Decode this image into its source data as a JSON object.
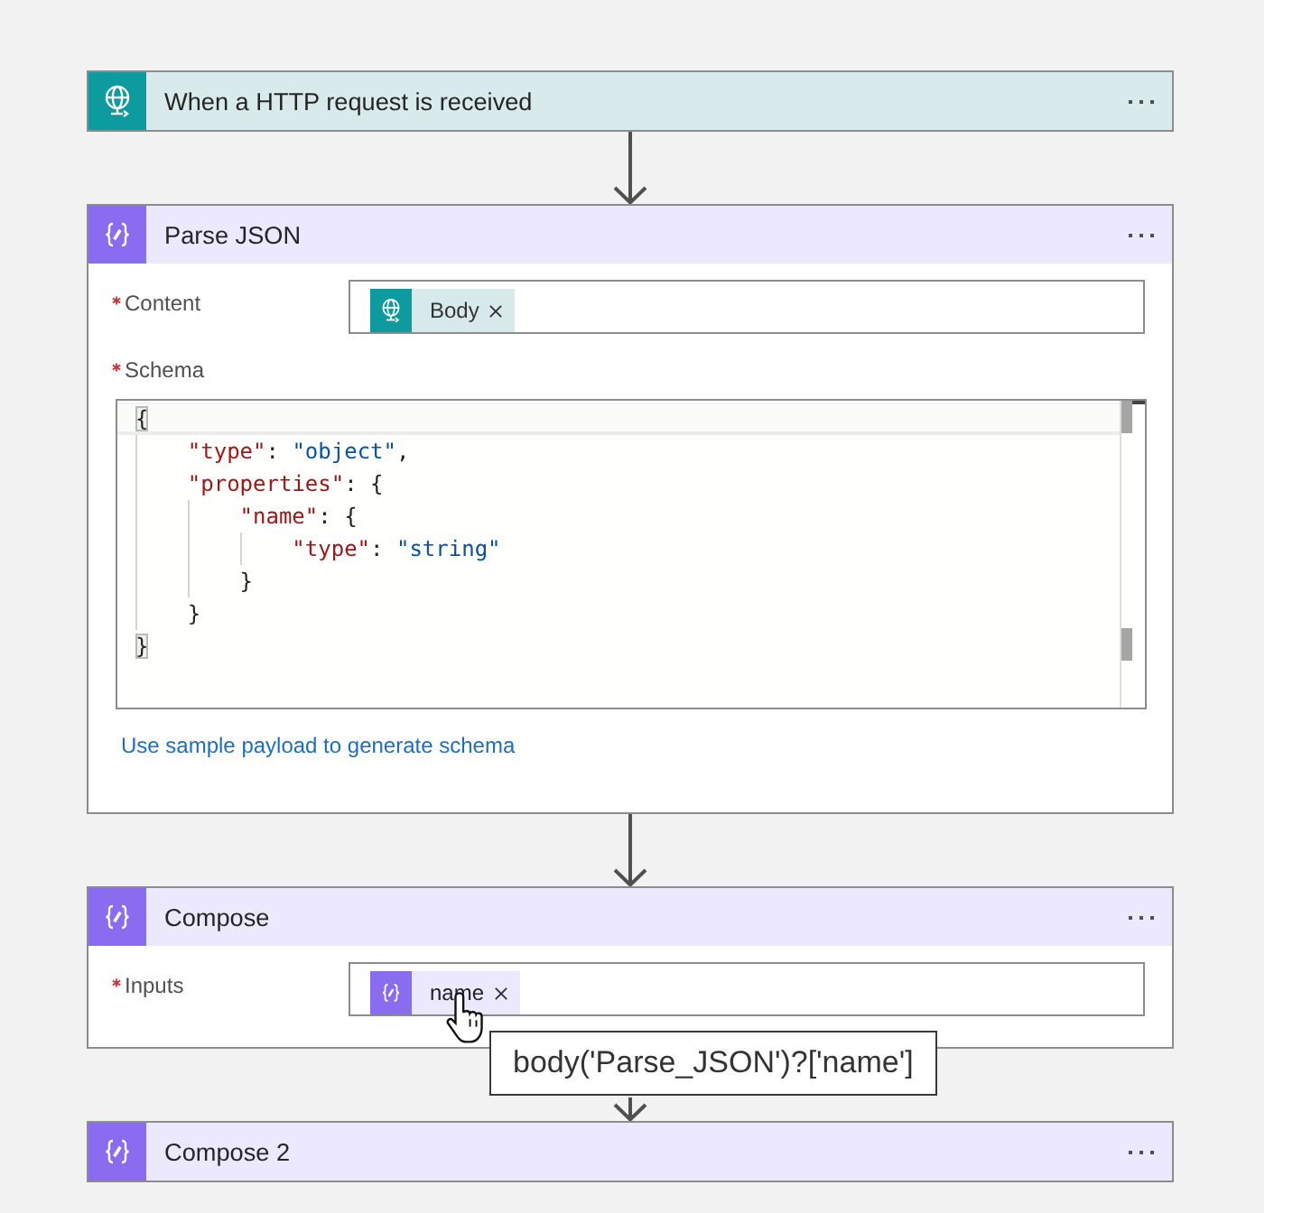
{
  "cards": [
    {
      "kind": "trigger",
      "title": "When a HTTP request is received"
    },
    {
      "kind": "action",
      "title": "Parse JSON",
      "fields": [
        {
          "kind": "tokens",
          "label": "Content",
          "required": true,
          "tokens": [
            {
              "kind": "trigger",
              "text": "Body",
              "hovered": false
            }
          ]
        },
        {
          "kind": "code",
          "label": "Schema",
          "required": true,
          "code": {
            "active": true,
            "open": [
              {
                "kind": "punct",
                "text": "{"
              }
            ],
            "children": [
              {
                "active": false,
                "open": [
                  {
                    "kind": "key",
                    "text": "\"type\""
                  },
                  {
                    "kind": "punct",
                    "text": ": "
                  },
                  {
                    "kind": "string",
                    "text": "\"object\""
                  },
                  {
                    "kind": "punct",
                    "text": ","
                  }
                ]
              },
              {
                "active": false,
                "open": [
                  {
                    "kind": "key",
                    "text": "\"properties\""
                  },
                  {
                    "kind": "punct",
                    "text": ": {"
                  }
                ],
                "children": [
                  {
                    "active": false,
                    "open": [
                      {
                        "kind": "key",
                        "text": "\"name\""
                      },
                      {
                        "kind": "punct",
                        "text": ": {"
                      }
                    ],
                    "children": [
                      {
                        "active": false,
                        "open": [
                          {
                            "kind": "key",
                            "text": "\"type\""
                          },
                          {
                            "kind": "punct",
                            "text": ": "
                          },
                          {
                            "kind": "string",
                            "text": "\"string\""
                          }
                        ]
                      }
                    ],
                    "close": [
                      {
                        "kind": "punct",
                        "text": "}"
                      }
                    ]
                  }
                ],
                "close": [
                  {
                    "kind": "punct",
                    "text": "}"
                  }
                ]
              }
            ],
            "close": [
              {
                "kind": "punct",
                "text": "}"
              }
            ]
          }
        }
      ],
      "link": "Use sample payload to generate schema"
    },
    {
      "kind": "action",
      "title": "Compose",
      "fields": [
        {
          "kind": "tokens",
          "label": "Inputs",
          "required": true,
          "tokens": [
            {
              "kind": "action",
              "text": "name",
              "hovered": true,
              "tooltip": "body('Parse_JSON')?['name']"
            }
          ]
        }
      ]
    },
    {
      "kind": "action",
      "title": "Compose 2"
    }
  ]
}
